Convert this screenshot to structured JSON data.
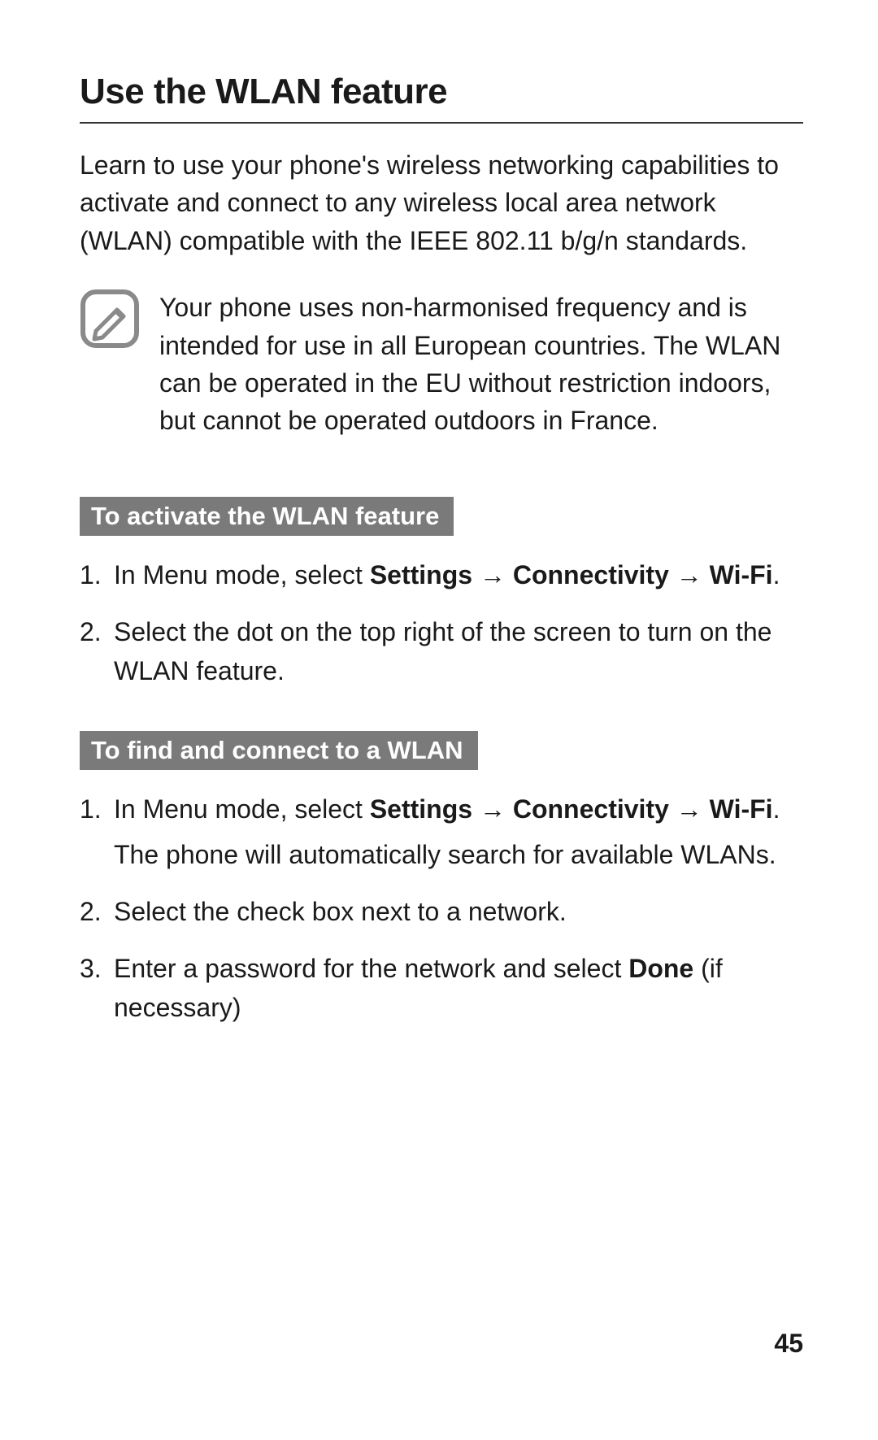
{
  "title": "Use the WLAN feature",
  "intro": "Learn to use your phone's wireless networking capabilities to activate and connect to any wireless local area network (WLAN) compatible with the IEEE 802.11 b/g/n standards.",
  "note": "Your phone uses non-harmonised frequency and is intended for use in all European countries. The WLAN can be operated in the EU without restriction indoors, but cannot be operated outdoors in France.",
  "section1": {
    "heading": "To activate the WLAN feature",
    "step1_prefix": "In Menu mode, select ",
    "step1_b1": "Settings",
    "step1_arrow": " → ",
    "step1_b2": "Connectivity",
    "step1_b3": "Wi-Fi",
    "step1_suffix": ".",
    "step2": "Select the dot on the top right of the screen to turn on the WLAN feature."
  },
  "section2": {
    "heading": "To find and connect to a WLAN",
    "step1_prefix": "In Menu mode, select ",
    "step1_b1": "Settings",
    "step1_arrow": " → ",
    "step1_b2": "Connectivity",
    "step1_b3": "Wi-Fi",
    "step1_suffix": ".",
    "step1_cont": "The phone will automatically search for available WLANs.",
    "step2": "Select the check box next to a network.",
    "step3_prefix": "Enter a password for the network and select ",
    "step3_b1": "Done",
    "step3_suffix": " (if necessary)"
  },
  "page_number": "45"
}
